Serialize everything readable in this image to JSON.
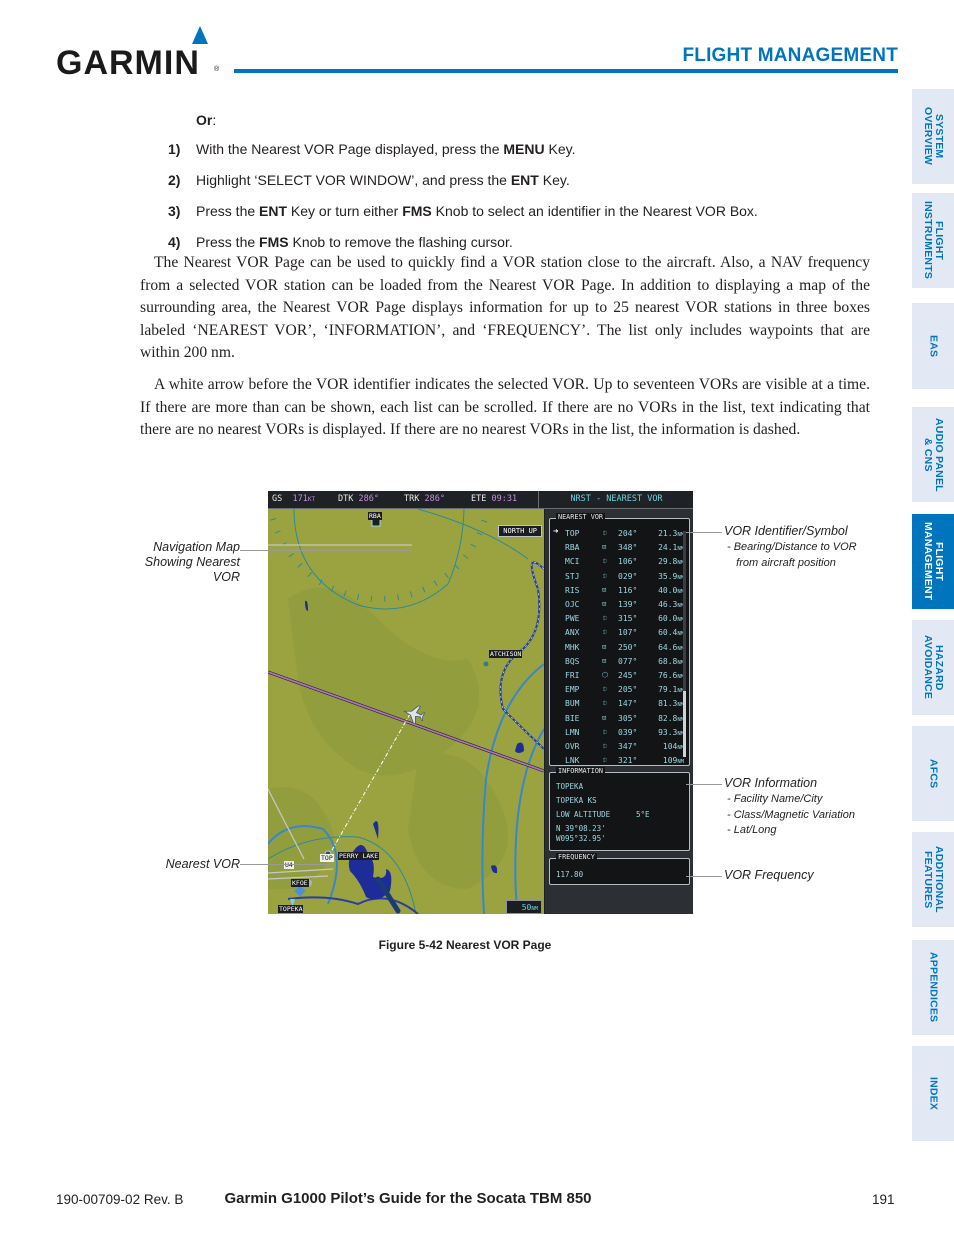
{
  "header": {
    "logo_text": "GARMIN",
    "logo_reg": "®",
    "section_title": "FLIGHT MANAGEMENT",
    "accent_color": "#0075be"
  },
  "side_tabs": [
    {
      "label": "SYSTEM\nOVERVIEW",
      "active": false
    },
    {
      "label": "FLIGHT\nINSTRUMENTS",
      "active": false
    },
    {
      "label": "EAS",
      "active": false
    },
    {
      "label": "AUDIO PANEL\n& CNS",
      "active": false
    },
    {
      "label": "FLIGHT\nMANAGEMENT",
      "active": true
    },
    {
      "label": "HAZARD\nAVOIDANCE",
      "active": false
    },
    {
      "label": "AFCS",
      "active": false
    },
    {
      "label": "ADDITIONAL\nFEATURES",
      "active": false
    },
    {
      "label": "APPENDICES",
      "active": false
    },
    {
      "label": "INDEX",
      "active": false
    }
  ],
  "body": {
    "or_label": "Or",
    "or_colon": ":",
    "steps": [
      {
        "num": "1)",
        "parts": [
          {
            "t": "With the Nearest VOR Page displayed, press the "
          },
          {
            "t": "MENU",
            "b": true
          },
          {
            "t": " Key."
          }
        ]
      },
      {
        "num": "2)",
        "parts": [
          {
            "t": "Highlight ‘SELECT VOR WINDOW’, and press the "
          },
          {
            "t": "ENT",
            "b": true
          },
          {
            "t": " Key."
          }
        ]
      },
      {
        "num": "3)",
        "parts": [
          {
            "t": "Press the "
          },
          {
            "t": "ENT",
            "b": true
          },
          {
            "t": " Key or turn either "
          },
          {
            "t": "FMS",
            "b": true
          },
          {
            "t": " Knob to select an identifier in the Nearest VOR Box."
          }
        ]
      },
      {
        "num": "4)",
        "parts": [
          {
            "t": "Press the "
          },
          {
            "t": "FMS",
            "b": true
          },
          {
            "t": " Knob to remove the flashing cursor."
          }
        ]
      }
    ],
    "paragraphs": [
      "The Nearest VOR Page can be used to quickly find a VOR station close to the aircraft.  Also, a NAV frequency from a selected VOR station can be loaded from the Nearest VOR Page.  In addition to displaying a map of the surrounding area, the Nearest VOR Page displays information for up to 25 nearest VOR stations in three boxes labeled ‘NEAREST VOR’, ‘INFORMATION’, and ‘FREQUENCY’.  The list only includes waypoints that are within 200 nm.",
      "A white arrow before the VOR identifier indicates the selected VOR.  Up to seventeen VORs are visible at a time.  If there are more than can be shown, each list can be scrolled.  If there are no VORs in the list, text indicating that there are no nearest VORs is displayed.  If there are no nearest VORs in the list, the information is dashed."
    ]
  },
  "figure": {
    "topbar": {
      "gs_label": "GS",
      "gs_value": "171",
      "gs_unit": "KT",
      "dtk_label": "DTK",
      "dtk_value": "286°",
      "trk_label": "TRK",
      "trk_value": "286°",
      "ete_label": "ETE",
      "ete_value": "09:31",
      "page_title": "NRST - NEAREST VOR"
    },
    "map": {
      "orientation": "NORTH UP",
      "scale": "50",
      "scale_unit": "NM",
      "labels": {
        "rba": "RBA",
        "atchison": "ATCHISON",
        "perry_lake": "PERRY LAKE",
        "top": "TOP",
        "u4": "U4",
        "kfoe": "KFOE",
        "topeka": "TOPEKA"
      }
    },
    "nearest_vor": {
      "label": "NEAREST VOR",
      "selected_index": 0,
      "rows": [
        {
          "id": "TOP",
          "symbol": "vortac",
          "bearing": "204°",
          "distance": "21.3",
          "unit": "NM"
        },
        {
          "id": "RBA",
          "symbol": "vor-dme",
          "bearing": "348°",
          "distance": "24.1",
          "unit": "NM"
        },
        {
          "id": "MCI",
          "symbol": "vortac",
          "bearing": "106°",
          "distance": "29.8",
          "unit": "NM"
        },
        {
          "id": "STJ",
          "symbol": "vortac",
          "bearing": "029°",
          "distance": "35.9",
          "unit": "NM"
        },
        {
          "id": "RIS",
          "symbol": "vor-dme",
          "bearing": "116°",
          "distance": "40.0",
          "unit": "NM"
        },
        {
          "id": "OJC",
          "symbol": "vor-dme",
          "bearing": "139°",
          "distance": "46.3",
          "unit": "NM"
        },
        {
          "id": "PWE",
          "symbol": "vortac",
          "bearing": "315°",
          "distance": "60.0",
          "unit": "NM"
        },
        {
          "id": "ANX",
          "symbol": "vortac",
          "bearing": "107°",
          "distance": "60.4",
          "unit": "NM"
        },
        {
          "id": "MHK",
          "symbol": "vor-dme",
          "bearing": "250°",
          "distance": "64.6",
          "unit": "NM"
        },
        {
          "id": "BQS",
          "symbol": "vor-dme",
          "bearing": "077°",
          "distance": "68.8",
          "unit": "NM"
        },
        {
          "id": "FRI",
          "symbol": "vor",
          "bearing": "245°",
          "distance": "76.6",
          "unit": "NM"
        },
        {
          "id": "EMP",
          "symbol": "vortac",
          "bearing": "205°",
          "distance": "79.1",
          "unit": "NM"
        },
        {
          "id": "BUM",
          "symbol": "vortac",
          "bearing": "147°",
          "distance": "81.3",
          "unit": "NM"
        },
        {
          "id": "BIE",
          "symbol": "vor-dme",
          "bearing": "305°",
          "distance": "82.8",
          "unit": "NM"
        },
        {
          "id": "LMN",
          "symbol": "vortac",
          "bearing": "039°",
          "distance": "93.3",
          "unit": "NM"
        },
        {
          "id": "OVR",
          "symbol": "vortac",
          "bearing": "347°",
          "distance": "104",
          "unit": "NM"
        },
        {
          "id": "LNK",
          "symbol": "vortac",
          "bearing": "321°",
          "distance": "109",
          "unit": "NM"
        }
      ],
      "symbol_glyphs": {
        "vortac": "⯐",
        "vor-dme": "⊡",
        "vor": "⬡"
      }
    },
    "information": {
      "label": "INFORMATION",
      "facility_name": "TOPEKA",
      "city": "TOPEKA KS",
      "class": "LOW ALTITUDE",
      "mag_var": "5°E",
      "lat": "N 39°08.23'",
      "lon": "W095°32.95'"
    },
    "frequency": {
      "label": "FREQUENCY",
      "value": "117.80"
    },
    "colors": {
      "map_terrain": "#9aa33f",
      "flight_path": "#b070c8",
      "range_ring": "#3a85d0",
      "vor_text": "#9ed8e4",
      "bezel": "#1d1f21"
    }
  },
  "callouts": {
    "nav_map": "Navigation Map\nShowing Nearest\nVOR",
    "nearest_vor": "Nearest VOR",
    "vor_identifier": "VOR Identifier/Symbol",
    "vor_identifier_sub": "- Bearing/Distance to VOR\n   from aircraft position",
    "vor_information": "VOR Information",
    "vor_information_sub": "- Facility Name/City\n- Class/Magnetic Variation\n- Lat/Long",
    "vor_frequency": "VOR Frequency"
  },
  "caption": "Figure 5-42  Nearest VOR Page",
  "footer": {
    "doc_number": "190-00709-02  Rev. B",
    "title": "Garmin G1000 Pilot’s Guide for the Socata TBM 850",
    "page": "191"
  }
}
